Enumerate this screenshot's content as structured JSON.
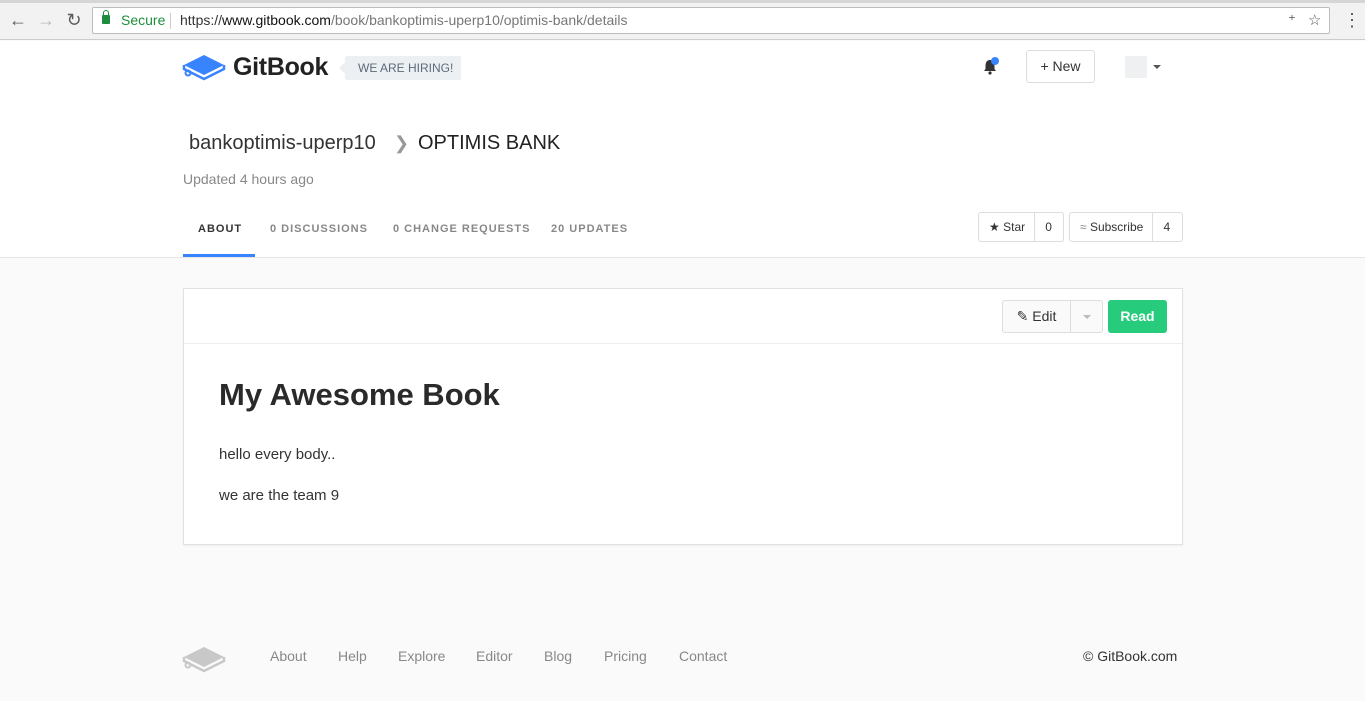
{
  "browser": {
    "secure_label": "Secure",
    "url_scheme": "https://",
    "url_host": "www.gitbook.com",
    "url_path": "/book/bankoptimis-uperp10/optimis-bank/details"
  },
  "header": {
    "brand": "GitBook",
    "hiring": "WE ARE HIRING!",
    "new_label": "New"
  },
  "book": {
    "owner": "bankoptimis-uperp10",
    "name": "OPTIMIS BANK",
    "updated": "Updated 4 hours ago"
  },
  "tabs": [
    {
      "label": "ABOUT",
      "active": true
    },
    {
      "label": "0 DISCUSSIONS",
      "active": false
    },
    {
      "label": "0 CHANGE REQUESTS",
      "active": false
    },
    {
      "label": "20 UPDATES",
      "active": false
    }
  ],
  "actions": {
    "star_label": "Star",
    "star_count": "0",
    "subscribe_label": "Subscribe",
    "subscribe_count": "4"
  },
  "card": {
    "edit_label": "Edit",
    "read_label": "Read",
    "title": "My Awesome Book",
    "paragraphs": [
      "hello every body..",
      "we are the team 9"
    ]
  },
  "footer": {
    "links": [
      "About",
      "Help",
      "Explore",
      "Editor",
      "Blog",
      "Pricing",
      "Contact"
    ],
    "copyright": "© GitBook.com"
  },
  "colors": {
    "accent": "#3884ff",
    "read_button": "#26cb7c",
    "secure": "#1e8e3e"
  }
}
